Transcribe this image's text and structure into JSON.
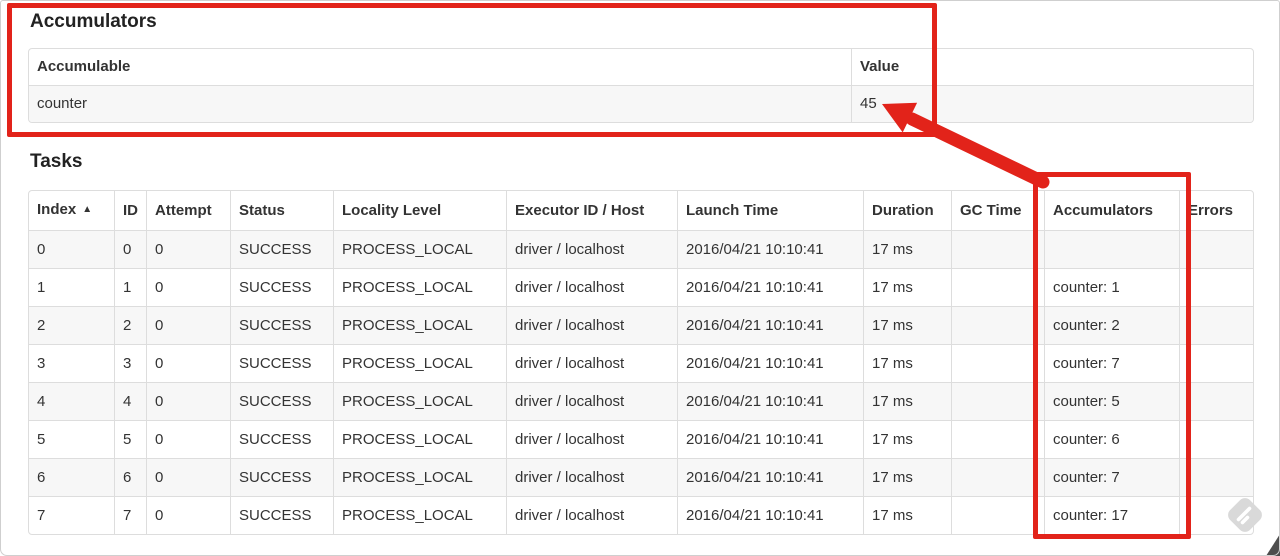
{
  "accumulators_section": {
    "heading": "Accumulators",
    "table": {
      "headers": [
        "Accumulable",
        "Value"
      ],
      "rows": [
        [
          "counter",
          "45"
        ]
      ]
    }
  },
  "tasks_section": {
    "heading": "Tasks",
    "table": {
      "headers": [
        "Index",
        "ID",
        "Attempt",
        "Status",
        "Locality Level",
        "Executor ID / Host",
        "Launch Time",
        "Duration",
        "GC Time",
        "Accumulators",
        "Errors"
      ],
      "sorted_column_index": 0,
      "sort_indicator_icon": "▲",
      "rows": [
        [
          "0",
          "0",
          "0",
          "SUCCESS",
          "PROCESS_LOCAL",
          "driver / localhost",
          "2016/04/21 10:10:41",
          "17 ms",
          "",
          "",
          ""
        ],
        [
          "1",
          "1",
          "0",
          "SUCCESS",
          "PROCESS_LOCAL",
          "driver / localhost",
          "2016/04/21 10:10:41",
          "17 ms",
          "",
          "counter: 1",
          ""
        ],
        [
          "2",
          "2",
          "0",
          "SUCCESS",
          "PROCESS_LOCAL",
          "driver / localhost",
          "2016/04/21 10:10:41",
          "17 ms",
          "",
          "counter: 2",
          ""
        ],
        [
          "3",
          "3",
          "0",
          "SUCCESS",
          "PROCESS_LOCAL",
          "driver / localhost",
          "2016/04/21 10:10:41",
          "17 ms",
          "",
          "counter: 7",
          ""
        ],
        [
          "4",
          "4",
          "0",
          "SUCCESS",
          "PROCESS_LOCAL",
          "driver / localhost",
          "2016/04/21 10:10:41",
          "17 ms",
          "",
          "counter: 5",
          ""
        ],
        [
          "5",
          "5",
          "0",
          "SUCCESS",
          "PROCESS_LOCAL",
          "driver / localhost",
          "2016/04/21 10:10:41",
          "17 ms",
          "",
          "counter: 6",
          ""
        ],
        [
          "6",
          "6",
          "0",
          "SUCCESS",
          "PROCESS_LOCAL",
          "driver / localhost",
          "2016/04/21 10:10:41",
          "17 ms",
          "",
          "counter: 7",
          ""
        ],
        [
          "7",
          "7",
          "0",
          "SUCCESS",
          "PROCESS_LOCAL",
          "driver / localhost",
          "2016/04/21 10:10:41",
          "17 ms",
          "",
          "counter: 17",
          ""
        ]
      ]
    }
  },
  "annotations": {
    "boxes": [
      "accumulators-summary",
      "tasks-accumulators-column"
    ],
    "arrow_points_to_value": "45"
  },
  "icons": {
    "sort_ascending": "sort-ascending-icon",
    "watermark": "skitch-watermark-icon",
    "cursor": "cursor-arrow-fragment"
  },
  "colors": {
    "annotation_red": "#e2231a",
    "row_stripe": "#f7f7f7",
    "table_border": "#dddddd"
  }
}
